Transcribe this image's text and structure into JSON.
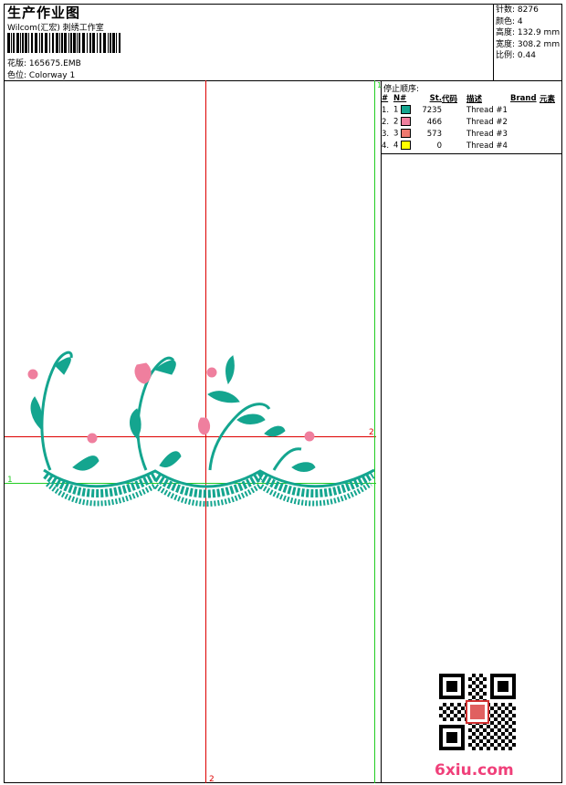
{
  "header": {
    "title": "生产作业图",
    "company": "Wilcom(汇宏) 刺绣工作室",
    "design_label": "花版:",
    "design_value": "165675.EMB",
    "colorway_label": "色位:",
    "colorway_value": "Colorway 1"
  },
  "stats": [
    {
      "label": "针数:",
      "value": "8276"
    },
    {
      "label": "颜色:",
      "value": "4"
    },
    {
      "label": "高度:",
      "value": "132.9 mm"
    },
    {
      "label": "宽度:",
      "value": "308.2 mm"
    },
    {
      "label": "比例:",
      "value": "0.44"
    }
  ],
  "stop_sequence": {
    "title": "停止顺序:",
    "columns": [
      "#",
      "N#",
      "St.",
      "代码",
      "描述",
      "Brand",
      "元素"
    ],
    "rows": [
      {
        "no": "1.",
        "n": "1",
        "color": "#14a58f",
        "stitches": "7235",
        "desc": "Thread #1"
      },
      {
        "no": "2.",
        "n": "2",
        "color": "#ef7f9e",
        "stitches": "466",
        "desc": "Thread #2"
      },
      {
        "no": "3.",
        "n": "3",
        "color": "#ee786e",
        "stitches": "573",
        "desc": "Thread #3"
      },
      {
        "no": "4.",
        "n": "4",
        "color": "#ffff00",
        "stitches": "0",
        "desc": "Thread #4"
      }
    ]
  },
  "guides": {
    "v_red_label": "2",
    "h_red_label": "2",
    "h_green_label": "1",
    "v_green_label": "1"
  },
  "colors": {
    "red_guide": "#dd0000",
    "green_guide": "#22cc22",
    "teal": "#14a58f",
    "pink": "#ef7f9e"
  },
  "watermark": {
    "site": "6xiu.com"
  }
}
